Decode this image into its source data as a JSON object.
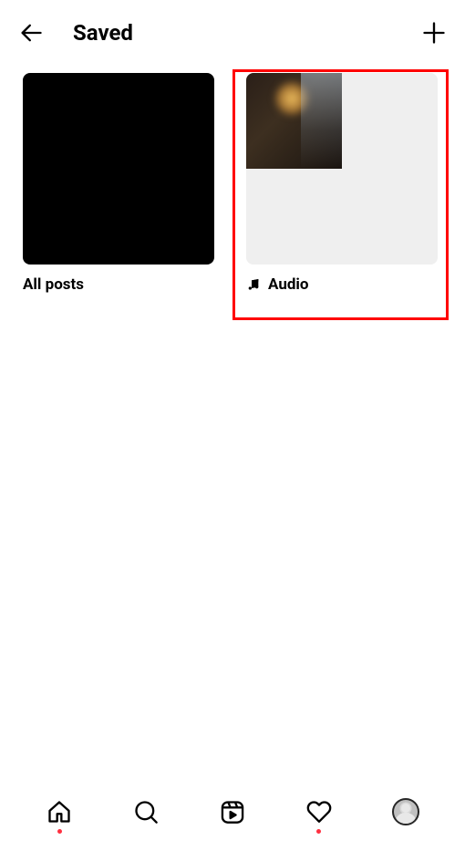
{
  "header": {
    "title": "Saved"
  },
  "collections": [
    {
      "label": "All posts",
      "has_icon": false
    },
    {
      "label": "Audio",
      "has_icon": true,
      "highlighted": true
    }
  ],
  "annotation": {
    "highlight_color": "#ff0000"
  },
  "nav": {
    "items": [
      "home",
      "search",
      "reels",
      "activity",
      "profile"
    ],
    "home_notification": true,
    "activity_notification": true
  }
}
